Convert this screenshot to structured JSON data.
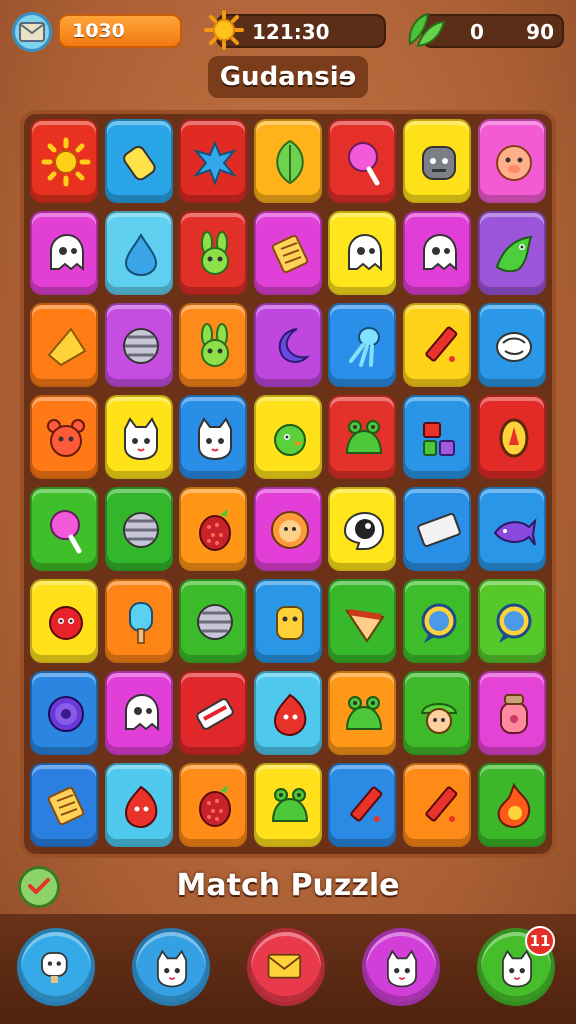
{
  "hud": {
    "coins": "1030",
    "timer": "121:30",
    "lives_current": "0",
    "lives_max": "90"
  },
  "title": "Gudansiɘ",
  "footer_title": "Match Puzzle",
  "board": {
    "columns": 7,
    "rows": [
      [
        {
          "color": "#e8321f",
          "icon": "sun-icon"
        },
        {
          "color": "#2aa6e8",
          "icon": "eraser-icon"
        },
        {
          "color": "#e02b24",
          "icon": "splat-icon"
        },
        {
          "color": "#ffb21a",
          "icon": "leaf-icon"
        },
        {
          "color": "#e5302a",
          "icon": "lollipop-icon"
        },
        {
          "color": "#ffe11a",
          "icon": "robot-face-icon"
        },
        {
          "color": "#f35bd4",
          "icon": "pig-face-icon"
        }
      ],
      [
        {
          "color": "#e23fd5",
          "icon": "ghost-icon"
        },
        {
          "color": "#5fd0f0",
          "icon": "drop-icon"
        },
        {
          "color": "#e22f27",
          "icon": "bunny-icon"
        },
        {
          "color": "#e040d8",
          "icon": "scroll-icon"
        },
        {
          "color": "#ffe61c",
          "icon": "ghost-icon"
        },
        {
          "color": "#e03ed6",
          "icon": "ghost-icon"
        },
        {
          "color": "#9a55d8",
          "icon": "dragon-icon"
        }
      ],
      [
        {
          "color": "#ff7b14",
          "icon": "cheese-icon"
        },
        {
          "color": "#c54de0",
          "icon": "ball-icon"
        },
        {
          "color": "#ff8a1c",
          "icon": "bunny-icon"
        },
        {
          "color": "#c046e0",
          "icon": "moon-icon"
        },
        {
          "color": "#2b8ee8",
          "icon": "squid-icon"
        },
        {
          "color": "#ffd21a",
          "icon": "pencil-icon"
        },
        {
          "color": "#2a98e6",
          "icon": "bug-icon"
        }
      ],
      [
        {
          "color": "#ff7a16",
          "icon": "bear-icon"
        },
        {
          "color": "#ffe218",
          "icon": "cat-icon"
        },
        {
          "color": "#2a8ee6",
          "icon": "cat-icon"
        },
        {
          "color": "#ffe21a",
          "icon": "bird-icon"
        },
        {
          "color": "#e3322a",
          "icon": "frog-icon"
        },
        {
          "color": "#2a95e6",
          "icon": "blocks-icon"
        },
        {
          "color": "#e22b27",
          "icon": "seed-icon"
        }
      ],
      [
        {
          "color": "#3fbf2a",
          "icon": "lollipop-icon"
        },
        {
          "color": "#33b62b",
          "icon": "ball-icon"
        },
        {
          "color": "#ff9616",
          "icon": "pinecone-icon"
        },
        {
          "color": "#e33fd8",
          "icon": "lion-icon"
        },
        {
          "color": "#ffe51a",
          "icon": "bomb-icon"
        },
        {
          "color": "#2a8fe6",
          "icon": "keyboard-icon"
        },
        {
          "color": "#2a96e8",
          "icon": "fish-icon"
        }
      ],
      [
        {
          "color": "#ffe21a",
          "icon": "fuzzball-icon"
        },
        {
          "color": "#ff8416",
          "icon": "popsicle-icon"
        },
        {
          "color": "#3cbb2a",
          "icon": "ball-icon"
        },
        {
          "color": "#2a97e6",
          "icon": "dog-icon"
        },
        {
          "color": "#38b82b",
          "icon": "pizza-icon"
        },
        {
          "color": "#3ebd2a",
          "icon": "bubble-icon"
        },
        {
          "color": "#56c92a",
          "icon": "bubble-icon"
        }
      ],
      [
        {
          "color": "#2a86e0",
          "icon": "ring-icon"
        },
        {
          "color": "#e23fd8",
          "icon": "ghost-icon"
        },
        {
          "color": "#e0282a",
          "icon": "candy-icon"
        },
        {
          "color": "#4fc8ee",
          "icon": "blob-icon"
        },
        {
          "color": "#ff9818",
          "icon": "frog-icon"
        },
        {
          "color": "#3eb92a",
          "icon": "hat-icon"
        },
        {
          "color": "#e443d6",
          "icon": "jar-icon"
        }
      ],
      [
        {
          "color": "#2a7fe0",
          "icon": "scroll-icon"
        },
        {
          "color": "#4fc9ee",
          "icon": "blob-icon"
        },
        {
          "color": "#ff8c18",
          "icon": "pinecone-icon"
        },
        {
          "color": "#ffe01a",
          "icon": "frog-icon"
        },
        {
          "color": "#2a8ae4",
          "icon": "pencil-icon"
        },
        {
          "color": "#ff8a18",
          "icon": "pencil-icon"
        },
        {
          "color": "#3cb72a",
          "icon": "flame-icon"
        }
      ]
    ]
  },
  "nav": {
    "badge": "11",
    "items": [
      {
        "color": "#36a9e8",
        "icon": "character-icon"
      },
      {
        "color": "#36a0e4",
        "icon": "cat-icon"
      },
      {
        "color": "#e83a4a",
        "icon": "mail-icon"
      },
      {
        "color": "#d13fd8",
        "icon": "cat-icon"
      },
      {
        "color": "#46be2c",
        "icon": "cat-icon"
      }
    ]
  }
}
